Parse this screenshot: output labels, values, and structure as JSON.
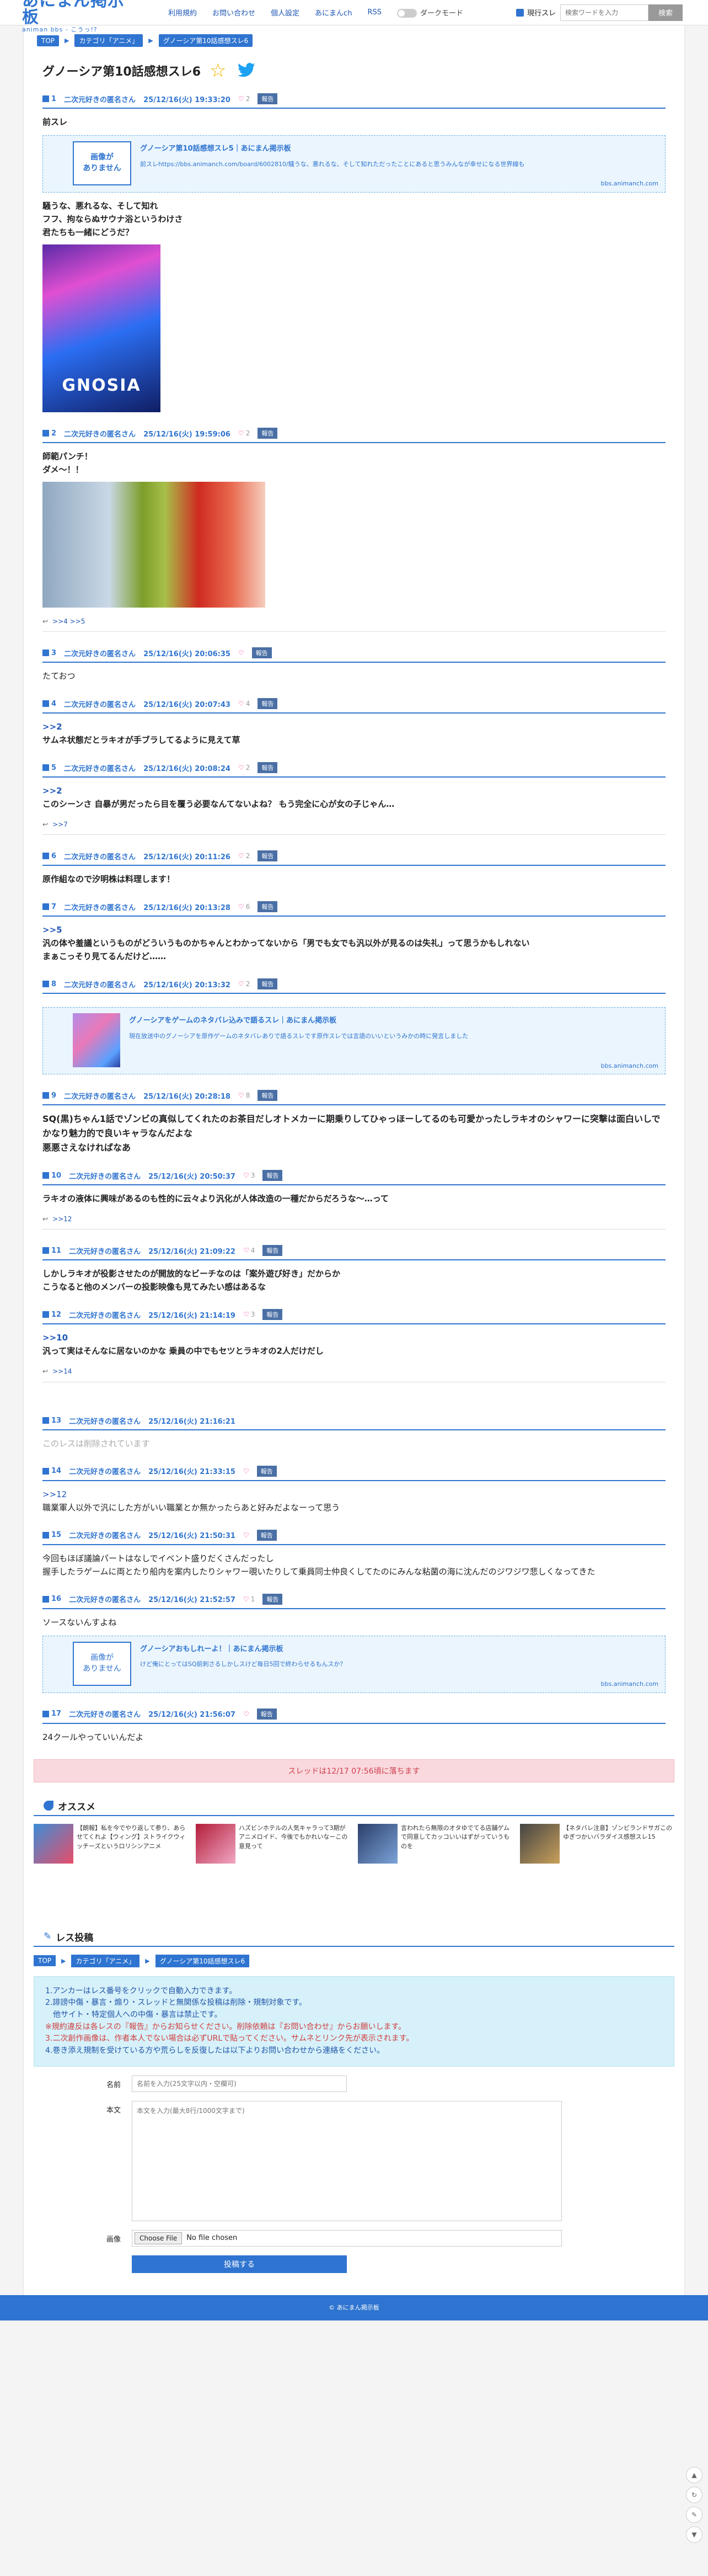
{
  "header": {
    "logo_main": "あにまん掲示板",
    "logo_sub": "animan bbs - こうっ!?",
    "nav": [
      "利用規約",
      "お問い合わせ",
      "個人設定",
      "あにまんch",
      "RSS"
    ],
    "dark_mode": "ダークモード",
    "search_label": "現行スレ",
    "search_placeholder": "検索ワードを入力",
    "search_button": "検索"
  },
  "breadcrumb": [
    "TOP",
    "カテゴリ「アニメ」",
    "グノーシア第10話感想スレ6"
  ],
  "thread_title": "グノーシア第10話感想スレ6",
  "posts": [
    {
      "num": "1",
      "name": "二次元好きの匿名さん",
      "date": "25/12/16(火) 19:33:20",
      "likes": "2",
      "report": "報告",
      "body": "前スレ",
      "card": {
        "noimg": "画像が\nありません",
        "title": "グノーシア第10話感想スレ5｜あにまん掲示板",
        "desc": "前スレhttps://bbs.animanch.com/board/6002810/騒うな、悪れるな、そして知れただったことにあると思うみんなが幸せになる世界線も",
        "domain": "bbs.animanch.com"
      },
      "extra": "騒うな、悪れるな、そして知れ\nフフ、拘ならぬサウナ浴というわけさ\n君たちも一緒にどうだ？",
      "poster": "GNOSIA"
    },
    {
      "num": "2",
      "name": "二次元好きの匿名さん",
      "date": "25/12/16(火) 19:59:06",
      "likes": "2",
      "report": "報告",
      "body": "師範パンチ！\nダメ〜！！",
      "replies": ">>4 >>5"
    },
    {
      "num": "3",
      "name": "二次元好きの匿名さん",
      "date": "25/12/16(火) 20:06:35",
      "likes": "",
      "report": "報告",
      "body": "たておつ"
    },
    {
      "num": "4",
      "name": "二次元好きの匿名さん",
      "date": "25/12/16(火) 20:07:43",
      "likes": "4",
      "report": "報告",
      "anchor": ">>2",
      "body": "サムネ状態だとラキオが手ブラしてるように見えて草"
    },
    {
      "num": "5",
      "name": "二次元好きの匿名さん",
      "date": "25/12/16(火) 20:08:24",
      "likes": "2",
      "report": "報告",
      "anchor": ">>2",
      "body": "このシーンさ 自暴が男だったら目を覆う必要なんてないよね？ もう完全に心が女の子じゃん…",
      "replies": ">>7"
    },
    {
      "num": "6",
      "name": "二次元好きの匿名さん",
      "date": "25/12/16(火) 20:11:26",
      "likes": "2",
      "report": "報告",
      "body": "原作組なので汐明株は料理します！"
    },
    {
      "num": "7",
      "name": "二次元好きの匿名さん",
      "date": "25/12/16(火) 20:13:28",
      "likes": "6",
      "report": "報告",
      "anchor": ">>5",
      "body": "汎の体や羞議というものがどういうものかちゃんとわかってないから「男でも女でも汎以外が見るのは失礼」って思うかもしれない\nまぁこっそり見てるんだけど……"
    },
    {
      "num": "8",
      "name": "二次元好きの匿名さん",
      "date": "25/12/16(火) 20:13:32",
      "likes": "2",
      "report": "報告",
      "card2": {
        "title": "グノーシアをゲームのネタバレ込みで語るスレ｜あにまん掲示板",
        "desc": "現在放送中のグノーシアを原作ゲームのネタバレありで語るスレです原作スレでは言語のいいというみかの時に発言しました",
        "domain": "bbs.animanch.com"
      }
    },
    {
      "num": "9",
      "name": "二次元好きの匿名さん",
      "date": "25/12/16(火) 20:28:18",
      "likes": "8",
      "report": "報告",
      "body": "SQ(黒)ちゃん1話でゾンビの真似してくれたのお茶目だしオトメカーに期乗りしてひゃっほーしてるのも可愛かったしラキオのシャワーに突撃は面白いしでかなり魅力的で良いキャラなんだよな\n悪悪さえなければなあ"
    },
    {
      "num": "10",
      "name": "二次元好きの匿名さん",
      "date": "25/12/16(火) 20:50:37",
      "likes": "3",
      "report": "報告",
      "body": "ラキオの液体に興味があるのも性的に云々より汎化が人体改造の一種だからだろうな〜…って",
      "replies": ">>12"
    },
    {
      "num": "11",
      "name": "二次元好きの匿名さん",
      "date": "25/12/16(火) 21:09:22",
      "likes": "4",
      "report": "報告",
      "body": "しかしラキオが役影させたのが開放的なビーチなのは「案外遊び好き」だからか\nこうなると他のメンバーの投影映像も見てみたい感はあるな"
    },
    {
      "num": "12",
      "name": "二次元好きの匿名さん",
      "date": "25/12/16(火) 21:14:19",
      "likes": "3",
      "report": "報告",
      "anchor": ">>10",
      "body": "汎って実はそんなに居ないのかな 乗員の中でもセツとラキオの2人だけだし",
      "replies": ">>14"
    },
    {
      "num": "13",
      "name": "二次元好きの匿名さん",
      "date": "25/12/16(火) 21:16:21",
      "deleted": "このレスは削除されています"
    },
    {
      "num": "14",
      "name": "二次元好きの匿名さん",
      "date": "25/12/16(火) 21:33:15",
      "likes": "",
      "report": "報告",
      "anchor": ">>12",
      "body": "職業軍人以外で汎にした方がいい職業とか無かったらあと好みだよなーって思う"
    },
    {
      "num": "15",
      "name": "二次元好きの匿名さん",
      "date": "25/12/16(火) 21:50:31",
      "likes": "",
      "report": "報告",
      "body": "今回もほぼ議論パートはなしでイベント盛りだくさんだったし\n握手したラゲームに両とたり船内を案内したりシャワー覗いたりして乗員同士仲良くしてたのにみんな粘菌の海に沈んだのジワジワ悲しくなってきた"
    },
    {
      "num": "16",
      "name": "二次元好きの匿名さん",
      "date": "25/12/16(火) 21:52:57",
      "likes": "1",
      "report": "報告",
      "body": "ソースないんすよね",
      "card": {
        "noimg": "画像が\nありません",
        "title": "グノーシアおもしれーよ！｜あにまん掲示板",
        "desc": "けど俺にとってはSQ前刺さるしかしスけど毎日5回で終わらせるもんスか？",
        "domain": "bbs.animanch.com"
      }
    },
    {
      "num": "17",
      "name": "二次元好きの匿名さん",
      "date": "25/12/16(火) 21:56:07",
      "likes": "",
      "report": "報告",
      "body": "24クールやっていいんだよ"
    }
  ],
  "fall_notice": "スレッドは12/17 07:56頃に落ちます",
  "recommend": {
    "title": "オススメ",
    "items": [
      {
        "text": "【朗報】私を今でやり返して参り、あらせてくれよ【ウィング】ストライクウィッチーズというロリシンアニメ"
      },
      {
        "text": "ハズビンホテルの人気キャラって3期がアニメロイド、今後でもかれいなーこの意見って"
      },
      {
        "text": "言われたら無限のオタゆでてる店舗ゲムで同意してカッコいいはずがっていうものを"
      },
      {
        "text": "【ネタバレ注意】ゾンビランドサガこのゆぎつかいバラダイス感想スレ15"
      }
    ]
  },
  "form": {
    "title": "レス投稿",
    "breadcrumb": [
      "TOP",
      "カテゴリ「アニメ」",
      "グノーシア第10話感想スレ6"
    ],
    "rules": [
      "1.アンカーはレス番号をクリックで自動入力できます。",
      "2.誹謗中傷・暴言・煽り・スレッドと無関係な投稿は削除・規制対象です。",
      "他サイト・特定個人への中傷・暴言は禁止です。",
      "※規約違反は各レスの『報告』からお知らせください。削除依頼は『お問い合わせ』からお願いします。",
      "3.二次創作画像は、作者本人でない場合は必ずURLで貼ってください。サムネとリンク先が表示されます。",
      "4.巻き添え規制を受けている方や荒らしを反復したは以下よりお問い合わせから連絡をください。"
    ],
    "name_label": "名前",
    "name_placeholder": "名前を入力(25文字以内・空欄可)",
    "body_label": "本文",
    "body_placeholder": "本文を入力(最大8行/1000文字まで)",
    "image_label": "画像",
    "file_button": "Choose File",
    "file_text": "No file chosen",
    "submit": "投稿する"
  },
  "footer": "© あにまん掲示板"
}
